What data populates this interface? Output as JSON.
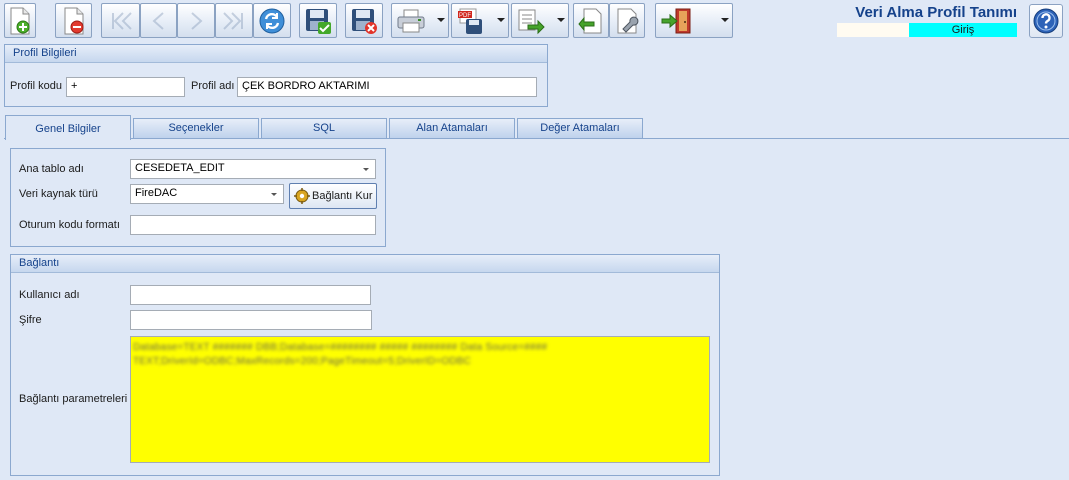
{
  "toolbar": {
    "buttons": [
      {
        "name": "new-button",
        "icon": "new-document-icon"
      },
      {
        "name": "delete-button",
        "icon": "delete-document-icon"
      },
      {
        "name": "first-record-button",
        "icon": "first-record-icon"
      },
      {
        "name": "previous-record-button",
        "icon": "previous-record-icon"
      },
      {
        "name": "next-record-button",
        "icon": "next-record-icon"
      },
      {
        "name": "last-record-button",
        "icon": "last-record-icon"
      },
      {
        "name": "refresh-button",
        "icon": "refresh-icon"
      },
      {
        "name": "save-button",
        "icon": "save-check-icon"
      },
      {
        "name": "cancel-button",
        "icon": "save-cancel-icon"
      },
      {
        "name": "print-button",
        "icon": "printer-icon"
      },
      {
        "name": "pdf-export-button",
        "icon": "pdf-save-icon"
      },
      {
        "name": "export-button",
        "icon": "export-icon"
      },
      {
        "name": "import-button",
        "icon": "import-icon"
      },
      {
        "name": "tools-button",
        "icon": "wrench-icon"
      },
      {
        "name": "exit-button",
        "icon": "exit-door-icon"
      }
    ]
  },
  "header": {
    "title": "Veri Alma Profil Tanımı",
    "mode": "Giriş",
    "mode_color": "#00ffff",
    "help_icon": "question-icon"
  },
  "profil": {
    "group_title": "Profil Bilgileri",
    "kod_label": "Profil kodu",
    "kod_value": "+",
    "ad_label": "Profil adı",
    "ad_value": "ÇEK BORDRO AKTARIMI"
  },
  "tabs": [
    {
      "label": "Genel Bilgiler",
      "active": true
    },
    {
      "label": "Seçenekler",
      "active": false
    },
    {
      "label": "SQL",
      "active": false
    },
    {
      "label": "Alan Atamaları",
      "active": false
    },
    {
      "label": "Değer Atamaları",
      "active": false
    }
  ],
  "genel": {
    "ana_tablo_label": "Ana tablo adı",
    "ana_tablo_value": "CESEDETA_EDIT",
    "veri_kaynak_label": "Veri kaynak türü",
    "veri_kaynak_value": "FireDAC",
    "baglanti_button": "Bağlantı Kur",
    "oturum_label": "Oturum kodu formatı",
    "oturum_value": ""
  },
  "baglanti": {
    "group_title": "Bağlantı",
    "kullanici_label": "Kullanıcı adı",
    "kullanici_value": "",
    "sifre_label": "Şifre",
    "sifre_value": "",
    "parametre_label": "Bağlantı parametreleri",
    "parametre_line1": "Database=TEXT ####### DBB;Database=######## ##### ######## Data Source=####",
    "parametre_line2": "TEXT;DriverId=ODBC;MaxRecords=200;PageTimeout=5;DriverID=ODBC",
    "memo_color": "#ffff00"
  }
}
